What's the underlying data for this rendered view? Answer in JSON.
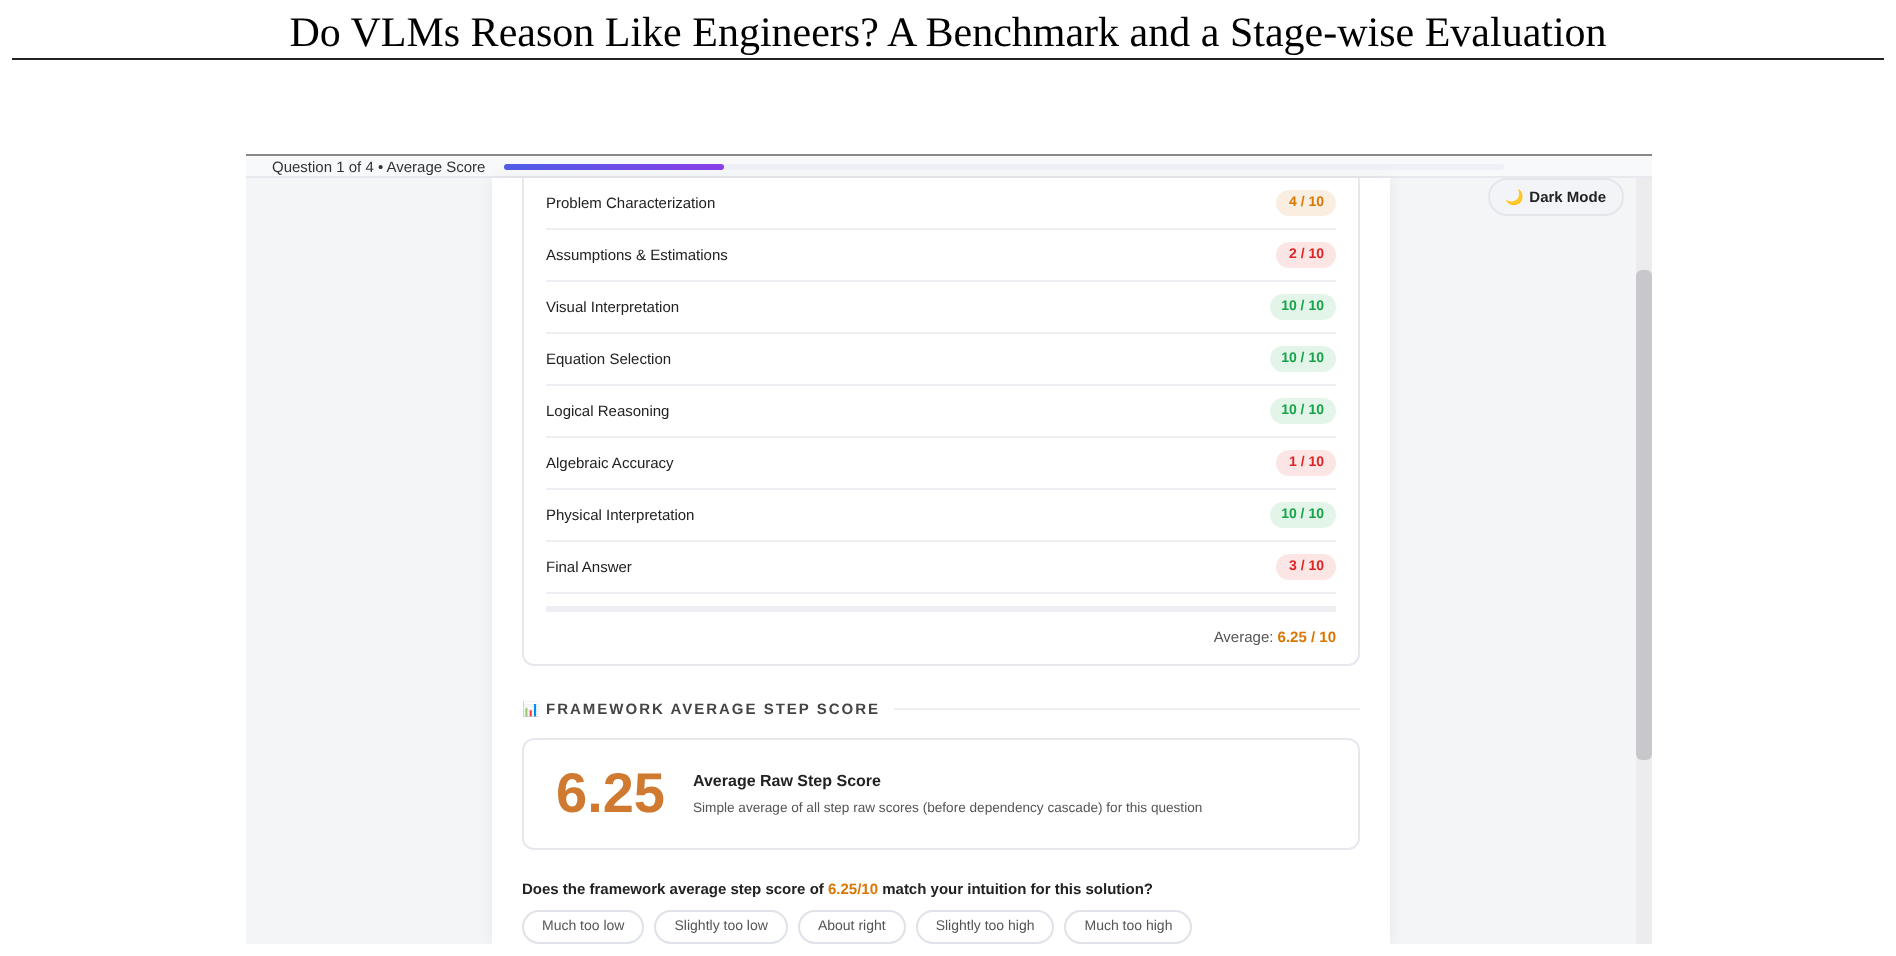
{
  "paper_title": "Do VLMs Reason Like Engineers? A Benchmark and a Stage-wise Evaluation",
  "top_bar": {
    "label": "Question 1 of 4 • Average Score",
    "level": 0.22
  },
  "dark_mode_button": {
    "icon": "🌙",
    "label": "Dark Mode"
  },
  "steps": [
    {
      "name": "Problem Characterization",
      "score": "4 / 10",
      "color": "#d97706"
    },
    {
      "name": "Assumptions & Estimations",
      "score": "2 / 10",
      "color": "#dc2626"
    },
    {
      "name": "Visual Interpretation",
      "score": "10 / 10",
      "color": "#16a34a"
    },
    {
      "name": "Equation Selection",
      "score": "10 / 10",
      "color": "#16a34a"
    },
    {
      "name": "Logical Reasoning",
      "score": "10 / 10",
      "color": "#16a34a"
    },
    {
      "name": "Algebraic Accuracy",
      "score": "1 / 10",
      "color": "#dc2626"
    },
    {
      "name": "Physical Interpretation",
      "score": "10 / 10",
      "color": "#16a34a"
    },
    {
      "name": "Final Answer",
      "score": "3 / 10",
      "color": "#dc2626"
    }
  ],
  "average": {
    "label": "Average:",
    "value": "6.25 / 10"
  },
  "section_heading": {
    "icon": "📊",
    "label": "FRAMEWORK AVERAGE STEP SCORE"
  },
  "score_card": {
    "value": "6.25",
    "title": "Average Raw Step Score",
    "description": "Simple average of all step raw scores (before dependency cascade) for this question"
  },
  "question": {
    "before": "Does the framework average step score of ",
    "highlight": "6.25/10",
    "after": " match your intuition for this solution?"
  },
  "options": [
    {
      "label": "Much too low",
      "selected": false
    },
    {
      "label": "Slightly too low",
      "selected": false
    },
    {
      "label": "About right",
      "selected": false
    },
    {
      "label": "Slightly too high",
      "selected": false
    },
    {
      "label": "Much too high",
      "selected": false
    }
  ]
}
